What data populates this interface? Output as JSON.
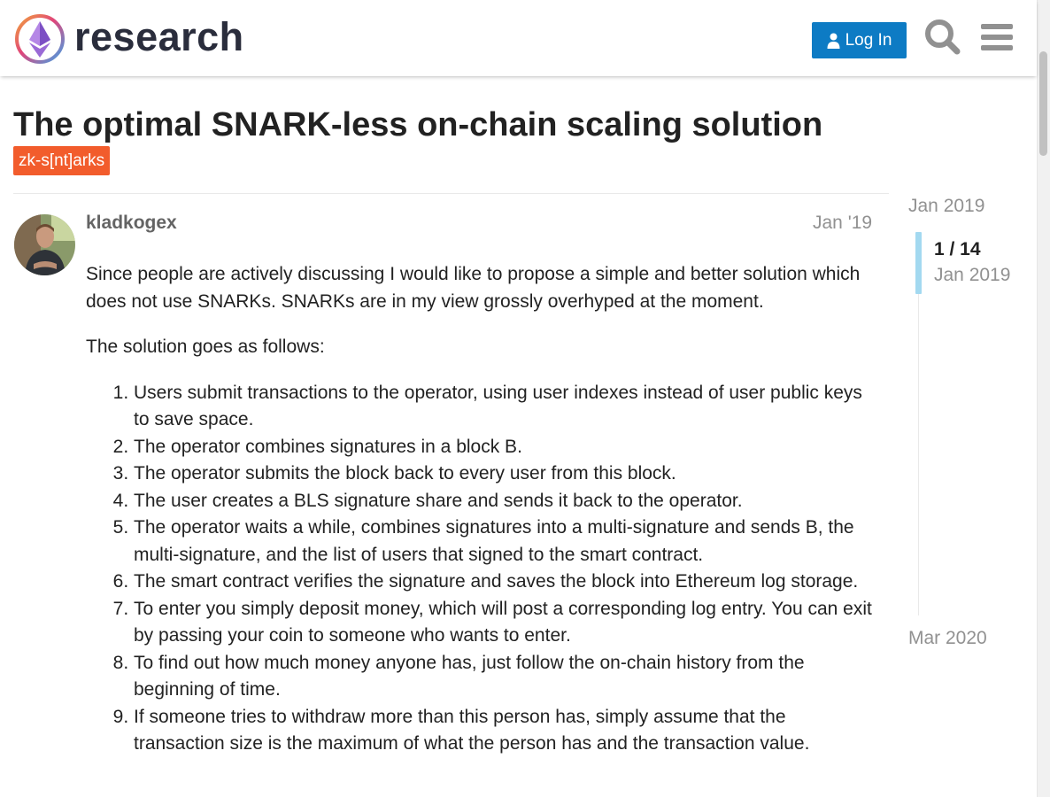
{
  "header": {
    "site_name": "research",
    "login_label": "Log In",
    "brand_color": "#0d7bc4"
  },
  "topic": {
    "title": "The optimal SNARK-less on-chain scaling solution",
    "tag": "zk-s[nt]arks",
    "tag_color": "#f25c2c"
  },
  "post": {
    "author": "kladkogex",
    "date": "Jan '19",
    "intro": "Since people are actively discussing I would like to propose a simple and better solution which does not use SNARKs. SNARKs are in my view grossly overhyped at the moment.",
    "lead": "The solution goes as follows:",
    "steps": [
      "Users submit transactions to the operator, using user indexes instead of user public keys to save space.",
      "The operator combines signatures in a block B.",
      "The operator submits the block back to every user from this block.",
      "The user creates a BLS signature share and sends it back to the operator.",
      "The operator waits a while, combines signatures into a multi-signature and sends B, the multi-signature, and the list of users that signed to the smart contract.",
      "The smart contract verifies the signature and saves the block into Ethereum log storage.",
      "To enter you simply deposit money, which will post a corresponding log entry. You can exit by passing your coin to someone who wants to enter.",
      "To find out how much money anyone has, just follow the on-chain history from the beginning of time.",
      "If someone tries to withdraw more than this person has, simply assume that the transaction size is the maximum of what the person has and the transaction value."
    ]
  },
  "timeline": {
    "start": "Jan 2019",
    "position": "1 / 14",
    "current_date": "Jan 2019",
    "end": "Mar 2020"
  },
  "icons": {
    "search": "search-icon",
    "menu": "hamburger-menu-icon",
    "user": "user-icon",
    "logo": "ethereum-logo-icon"
  }
}
